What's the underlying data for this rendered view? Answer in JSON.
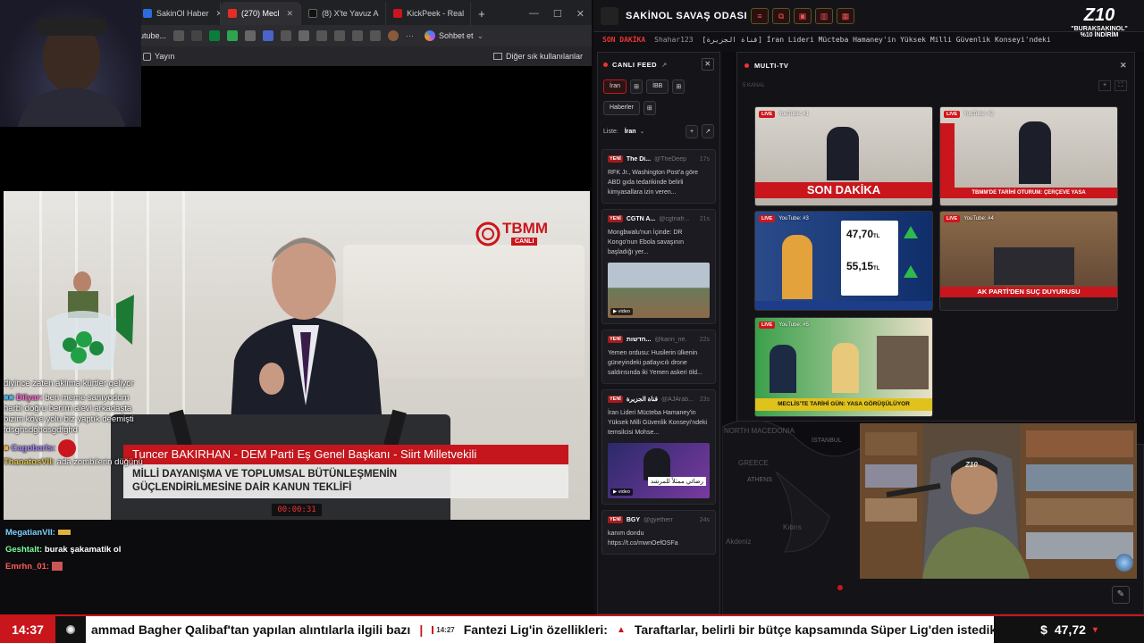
{
  "browser": {
    "tabs": [
      {
        "label": "SakinOl Haber",
        "color": "#2d6cdf",
        "active": false
      },
      {
        "label": "(270) Mecl",
        "color": "#e52d27",
        "active": true
      },
      {
        "label": "(8) X'te Yavuz A",
        "color": "#111111",
        "active": false
      },
      {
        "label": "KickPeek - Real",
        "color": "#c9161c",
        "active": false
      }
    ],
    "new_tab": "+",
    "window_controls": [
      "—",
      "☐",
      "✕"
    ],
    "address": "utube...",
    "chat_button": "Sohbet et",
    "bookmark_left": "Yayın",
    "bookmark_right": "Diğer sık kullanılanlar"
  },
  "video": {
    "channel_logo": "TBMM",
    "channel_sub": "CANLI",
    "speaker_name": "Tuncer BAKIRHAN - DEM Parti Eş Genel Başkanı - Siirt Milletvekili",
    "subtitle_line1": "MİLLİ DAYANIŞMA VE TOPLUMSAL BÜTÜNLEŞMENİN",
    "subtitle_line2": "GÜÇLENDİRİLMESİNE DAİR KANUN TEKLİFİ",
    "timer": "00:00:31"
  },
  "chat_overlay": [
    {
      "user": "",
      "text": "diyince zaten aklıma kürtler geliyor",
      "color": "#ffffff"
    },
    {
      "user": "Dilyar:",
      "text": "ben meme sanıyodum harbi doğru benim alevi arkadaşta bizim köye yolu biz yaptık deemişti fdsghsdghdsgdfghd",
      "color": "#ff6ad5"
    },
    {
      "user": "Cagobarls:",
      "text": "",
      "color": "#a98cff"
    },
    {
      "user": "ThanatosVII:",
      "text": "ada zombilerin düğünü",
      "color": "#e0c44a"
    }
  ],
  "chat_bottom": [
    {
      "user": "MegatianVII:",
      "text": "",
      "color": "#7cd0ff"
    },
    {
      "user": "Geshtalt:",
      "text": "burak şakamatik ol",
      "color": "#7cff9a"
    },
    {
      "user": "Emrhn_01:",
      "text": "",
      "color": "#ff5a5a"
    }
  ],
  "dashboard": {
    "title": "SAKİNOL SAVAŞ ODASI",
    "header_buttons": [
      "≡",
      "⧉",
      "▣",
      "▥",
      "▦"
    ],
    "ticker_tag": "SON DAKİKA",
    "ticker_user": "Shahar123",
    "ticker_text": "[قناة الجزيرة] İran Lideri Mücteba Hamaney'in Yüksek Milli Güvenlik Konseyi'ndeki temsilcisi Mohs",
    "promo_logo": "Z10",
    "promo_code": "\"BURAKSAKINOL\"",
    "promo_text": "%10 İNDİRİM"
  },
  "feed": {
    "title": "CANLI FEED",
    "close": "✕",
    "chips_row1": [
      "İran",
      "⊞",
      "İBB",
      "⊞"
    ],
    "chips_row2": [
      "Haberler",
      "⊞"
    ],
    "list_label": "Liste:",
    "list_value": "İran",
    "list_buttons": [
      "+",
      "↗"
    ],
    "new_label": "YENİ",
    "items": [
      {
        "src": "The Di...",
        "handle": "@TheDeepD...",
        "time": "17s",
        "text": "RFK Jr., Washington Post'a göre ABD gıda tedarikinde belirli kimyasallara izin veren...",
        "img": false
      },
      {
        "src": "CGTN A...",
        "handle": "@cgtnafr...",
        "time": "21s",
        "text": "Mongbwalu'nun İçinde: DR Kongo'nun Ebola savaşının başladığı yer...",
        "img": true,
        "img_tag": "▶ video"
      },
      {
        "src": "חדשות...",
        "handle": "@kann_ne...",
        "time": "22s",
        "text": "Yemen ordusu: Husilerin ülkenin güneyindeki patlayıcılı drone saldırısında iki Yemen askeri öld...",
        "img": false
      },
      {
        "src": "قناة الجزيرة",
        "handle": "@AJArab...",
        "time": "23s",
        "text": "İran Lideri Mücteba Hamaney'in Yüksek Milli Güvenlik Konseyi'ndeki temsilcisi Mohse...",
        "img": true,
        "img_tag": "▶ video",
        "img_caption": "رضائي ممثلاً للمرشد"
      },
      {
        "src": "BGY",
        "handle": "@gyetherr",
        "time": "24s",
        "text": "kanım dondu https://t.co/mwnOefOSFa",
        "img": false
      }
    ]
  },
  "multitv": {
    "title": "MULTI-TV",
    "close": "✕",
    "sub_label": "5 KANAL",
    "controls": [
      "+",
      "⛶"
    ],
    "live_label": "LIVE",
    "channels": [
      {
        "label": "YouTube: #1",
        "banner": "SON DAKİKA",
        "banner_color": "#c9161c"
      },
      {
        "label": "YouTube: #2",
        "banner": "TBMM'DE TARİHİ OTURUM: ÇERÇEVE YASA",
        "banner_color": "#c9161c"
      },
      {
        "label": "YouTube: #3",
        "banner": "",
        "banner_color": "#1d3d8a",
        "price1": "47,70",
        "price2": "55,15",
        "unit": "TL"
      },
      {
        "label": "YouTube: #4",
        "banner": "AK PARTİ'DEN SUÇ DUYURUSU",
        "banner_color": "#c9161c"
      },
      {
        "label": "YouTube: #5",
        "banner": "MECLİS'TE TARİHİ GÜN: YASA GÖRÜŞÜLÜYOR",
        "banner_color": "#e0c21c"
      }
    ]
  },
  "map_labels": {
    "greece": "GREECE",
    "athens": "ATHENS",
    "macedonia": "NORTH MACEDONIA",
    "istanbul": "İSTANBUL",
    "cyprus": "Kıbrıs",
    "med": "Akdeniz"
  },
  "cam2": {
    "chair_logo": "Z10"
  },
  "ticker": {
    "time": "14:37",
    "items": [
      {
        "stamp": "",
        "text": "ammad Bagher Qalibaf'tan yapılan alıntılarla ilgili bazı"
      },
      {
        "stamp": "14:27",
        "text": "Fantezi Lig'in özellikleri:"
      },
      {
        "stamp": "",
        "text": "Taraftarlar, belirli bir bütçe kapsamında Süper Lig'den istedikleri"
      }
    ],
    "fx_symbol": "$",
    "fx_value": "47,72",
    "fx_arrow": "▾"
  },
  "colors": {
    "accent": "#c9161c",
    "brand_dark": "#101014",
    "tv_border": "#333333"
  }
}
